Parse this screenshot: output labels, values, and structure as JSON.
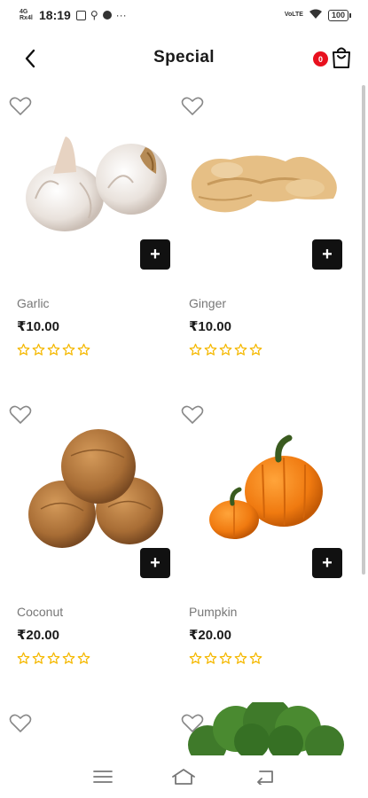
{
  "status_bar": {
    "network_top": "4G",
    "network_bottom": "Rx4l",
    "time": "18:19",
    "battery": "100",
    "lte": "VoLTE"
  },
  "header": {
    "title": "Special",
    "cart_count": "0"
  },
  "products": [
    {
      "name": "Garlic",
      "price": "₹10.00",
      "rating": 0,
      "icon": "garlic-image"
    },
    {
      "name": "Ginger",
      "price": "₹10.00",
      "rating": 0,
      "icon": "ginger-image"
    },
    {
      "name": "Coconut",
      "price": "₹20.00",
      "rating": 0,
      "icon": "coconut-image"
    },
    {
      "name": "Pumpkin",
      "price": "₹20.00",
      "rating": 0,
      "icon": "pumpkin-image"
    }
  ],
  "colors": {
    "star": "#f5b800",
    "badge": "#e8101e",
    "add_button": "#111111"
  },
  "nav": {
    "items": [
      "menu-icon",
      "home-icon",
      "back-icon"
    ]
  }
}
